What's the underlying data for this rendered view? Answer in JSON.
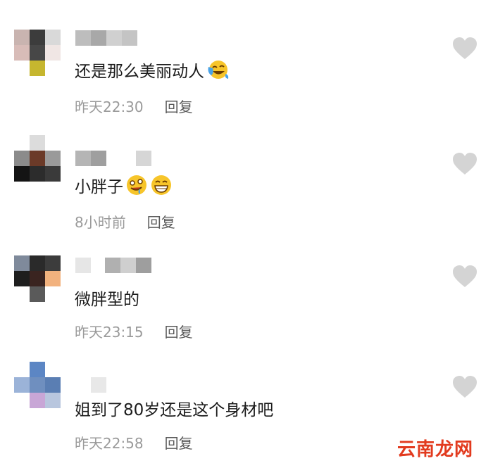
{
  "comments": [
    {
      "text": "还是那么美丽动人",
      "time": "昨天22:30",
      "reply": "回复",
      "emojis": [
        "laugh-cry-emoji"
      ]
    },
    {
      "text": "小胖子",
      "time": "8小时前",
      "reply": "回复",
      "emojis": [
        "drooling-emoji",
        "grin-emoji"
      ]
    },
    {
      "text": "微胖型的",
      "time": "昨天23:15",
      "reply": "回复",
      "emojis": []
    },
    {
      "text": "姐到了80岁还是这个身材吧",
      "time": "昨天22:58",
      "reply": "回复",
      "emojis": []
    }
  ],
  "icons": {
    "like": "heart-icon"
  },
  "colors": {
    "like_icon": "#d4d4d4",
    "meta_text": "#9a9a9a",
    "reply_text": "#595959"
  },
  "watermark": "云南龙网"
}
